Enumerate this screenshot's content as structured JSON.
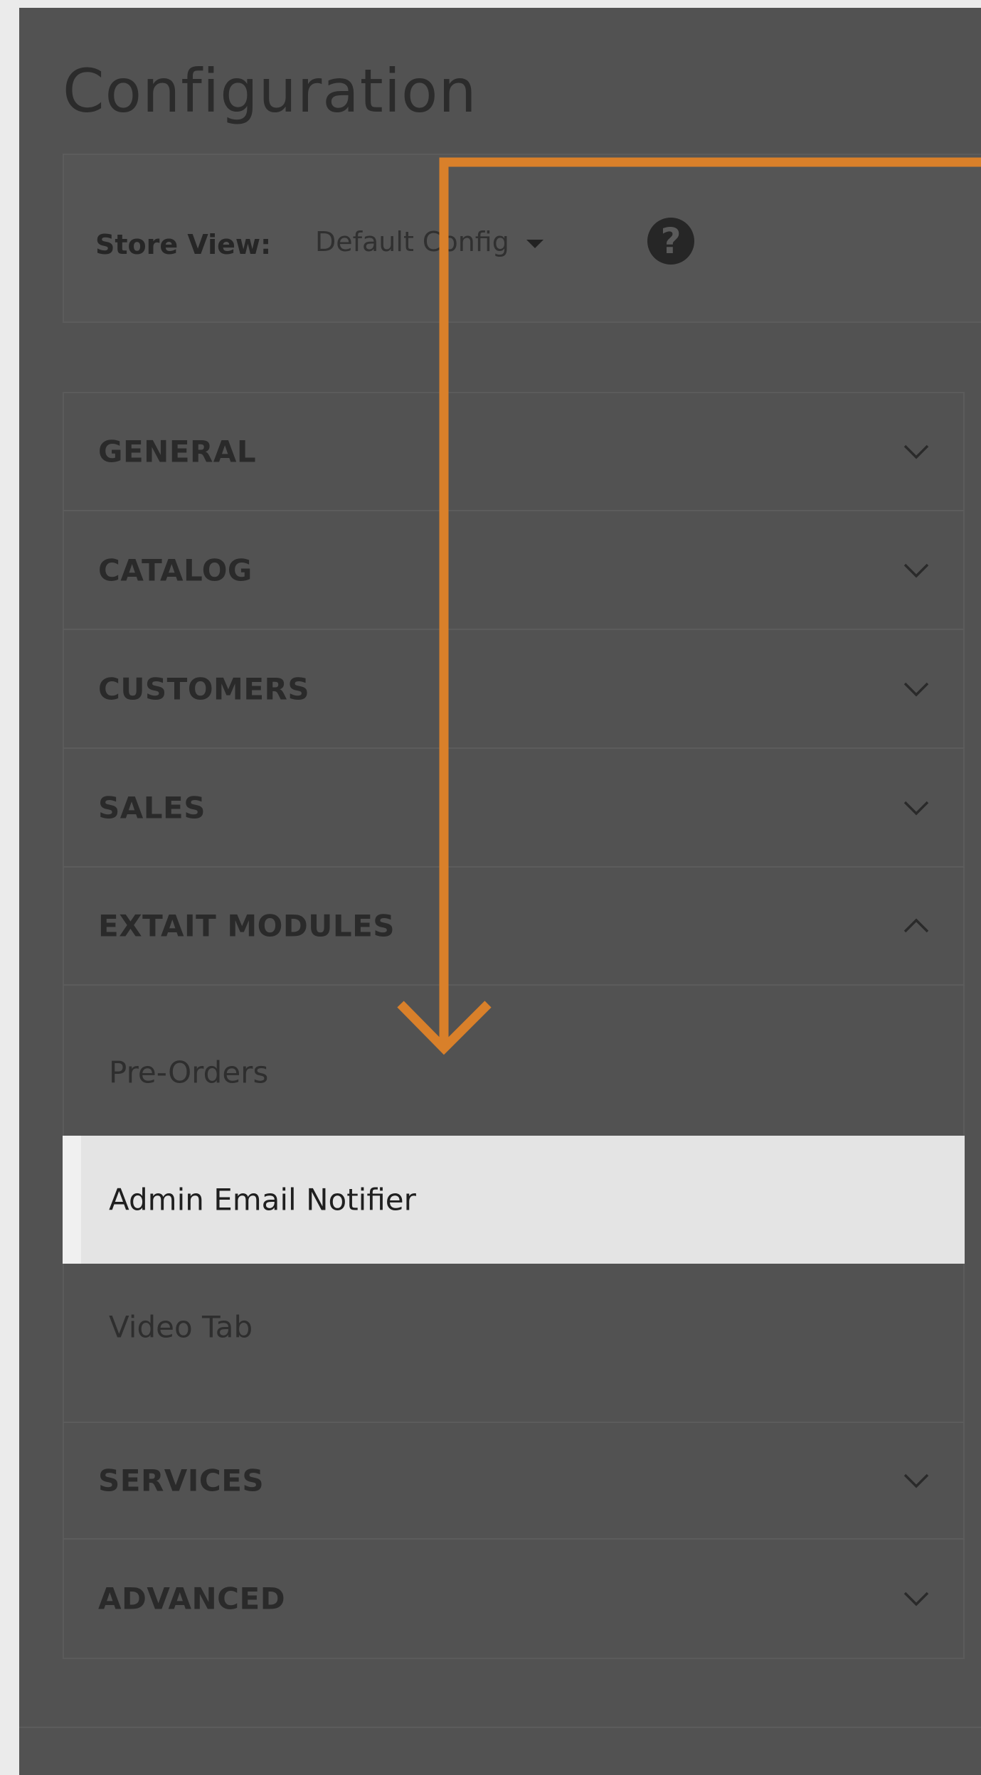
{
  "page": {
    "title": "Configuration"
  },
  "scope": {
    "label": "Store View:",
    "selected": "Default Config",
    "help_icon": "question-mark-icon"
  },
  "tabs": [
    {
      "label": "GENERAL",
      "state": "collapsed"
    },
    {
      "label": "CATALOG",
      "state": "collapsed"
    },
    {
      "label": "CUSTOMERS",
      "state": "collapsed"
    },
    {
      "label": "SALES",
      "state": "collapsed"
    },
    {
      "label": "EXTAIT MODULES",
      "state": "expanded"
    },
    {
      "label": "SERVICES",
      "state": "collapsed"
    },
    {
      "label": "ADVANCED",
      "state": "collapsed"
    }
  ],
  "extait_items": [
    {
      "label": "Pre-Orders",
      "active": false
    },
    {
      "label": "Admin Email Notifier",
      "active": true
    },
    {
      "label": "Video Tab",
      "active": false
    }
  ],
  "colors": {
    "overlay": "#525252",
    "active_item": "#e4e4e4",
    "annotation_arrow": "#d9802a"
  }
}
